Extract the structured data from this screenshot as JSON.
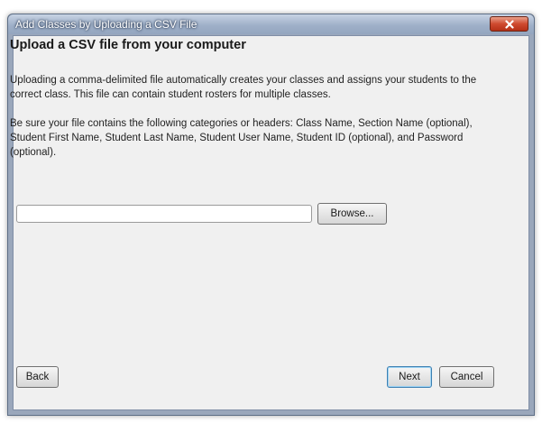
{
  "window": {
    "title": "Add Classes by Uploading a CSV File",
    "close_icon": "close-x-icon"
  },
  "content": {
    "heading": "Upload a CSV file from your computer",
    "paragraph1": "Uploading a comma-delimited file automatically creates your classes and assigns your students to the correct class. This file can contain student rosters for multiple classes.",
    "paragraph2": "Be sure your file contains the following categories or headers: Class Name, Section Name (optional), Student First Name, Student Last Name, Student User Name, Student ID (optional), and Password (optional)."
  },
  "file_picker": {
    "value": "",
    "browse_label": "Browse..."
  },
  "footer": {
    "back_label": "Back",
    "next_label": "Next",
    "cancel_label": "Cancel"
  },
  "colors": {
    "close_button": "#c94a2f",
    "dialog_background": "#f0f0f0",
    "default_button_border": "#3c7fb1"
  }
}
